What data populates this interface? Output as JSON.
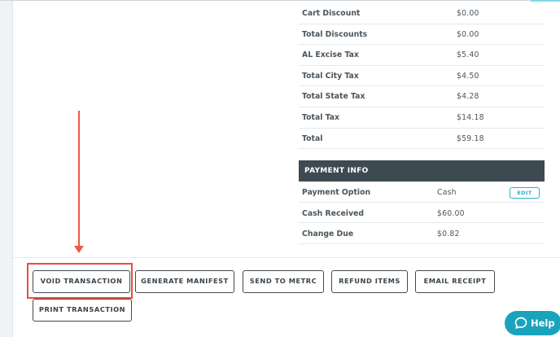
{
  "totals": [
    {
      "label": "Cart Discount",
      "value": "$0.00"
    },
    {
      "label": "Total Discounts",
      "value": "$0.00"
    },
    {
      "label": "AL Excise Tax",
      "value": "$5.40"
    },
    {
      "label": "Total City Tax",
      "value": "$4.50"
    },
    {
      "label": "Total State Tax",
      "value": "$4.28"
    },
    {
      "label": "Total Tax",
      "value": "$14.18"
    },
    {
      "label": "Total",
      "value": "$59.18"
    }
  ],
  "payment": {
    "header": "PAYMENT INFO",
    "rows": [
      {
        "label": "Payment Option",
        "value": "Cash",
        "action": "EDIT"
      },
      {
        "label": "Cash Received",
        "value": "$60.00"
      },
      {
        "label": "Change Due",
        "value": "$0.82"
      }
    ]
  },
  "actions": {
    "void": "VOID TRANSACTION",
    "manifest": "GENERATE MANIFEST",
    "metrc": "SEND TO METRC",
    "refund": "REFUND ITEMS",
    "email": "EMAIL RECEIPT",
    "print": "PRINT TRANSACTION"
  },
  "help": {
    "label": "Help",
    "icon": "chat-bubble-icon"
  },
  "colors": {
    "annotation": "#ea4d3d",
    "header_bg": "#3e4a52",
    "accent": "#1aa3bd"
  }
}
